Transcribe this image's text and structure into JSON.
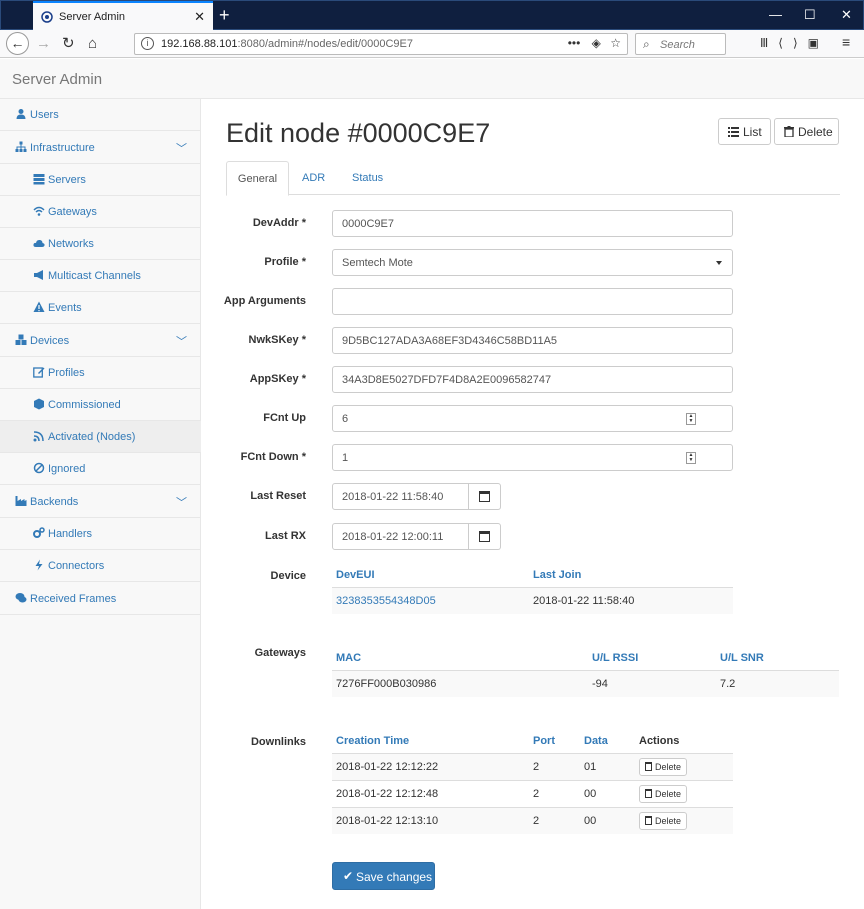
{
  "browser": {
    "tab_title": "Server Admin",
    "url_host": "192.168.88.101",
    "url_rest": ":8080/admin#/nodes/edit/0000C9E7",
    "search_placeholder": "Search",
    "url_actions": "•••"
  },
  "app": {
    "brand": "Server Admin"
  },
  "sidebar": {
    "items": [
      {
        "label": "Users",
        "icon": "user-icon"
      },
      {
        "label": "Infrastructure",
        "icon": "sitemap-icon"
      },
      {
        "label": "Servers",
        "icon": "server-icon"
      },
      {
        "label": "Gateways",
        "icon": "wifi-icon"
      },
      {
        "label": "Networks",
        "icon": "cloud-icon"
      },
      {
        "label": "Multicast Channels",
        "icon": "bullhorn-icon"
      },
      {
        "label": "Events",
        "icon": "warning-icon"
      },
      {
        "label": "Devices",
        "icon": "cubes-icon"
      },
      {
        "label": "Profiles",
        "icon": "edit-icon"
      },
      {
        "label": "Commissioned",
        "icon": "cube-icon"
      },
      {
        "label": "Activated (Nodes)",
        "icon": "rss-icon"
      },
      {
        "label": "Ignored",
        "icon": "ban-icon"
      },
      {
        "label": "Backends",
        "icon": "industry-icon"
      },
      {
        "label": "Handlers",
        "icon": "cogs-icon"
      },
      {
        "label": "Connectors",
        "icon": "bolt-icon"
      },
      {
        "label": "Received Frames",
        "icon": "comments-icon"
      }
    ]
  },
  "page": {
    "title": "Edit node #0000C9E7",
    "list_button": "List",
    "delete_button": "Delete"
  },
  "tabs": [
    "General",
    "ADR",
    "Status"
  ],
  "form": {
    "devaddr_label": "DevAddr *",
    "devaddr_value": "0000C9E7",
    "profile_label": "Profile *",
    "profile_value": "Semtech Mote",
    "app_args_label": "App Arguments",
    "app_args_value": "",
    "nwkskey_label": "NwkSKey *",
    "nwkskey_value": "9D5BC127ADA3A68EF3D4346C58BD11A5",
    "appskey_label": "AppSKey *",
    "appskey_value": "34A3D8E5027DFD7F4D8A2E0096582747",
    "fcntup_label": "FCnt Up",
    "fcntup_value": "6",
    "fcntdown_label": "FCnt Down *",
    "fcntdown_value": "1",
    "lastreset_label": "Last Reset",
    "lastreset_value": "2018-01-22 11:58:40",
    "lastrx_label": "Last RX",
    "lastrx_value": "2018-01-22 12:00:11",
    "device_label": "Device",
    "gateways_label": "Gateways",
    "downlinks_label": "Downlinks"
  },
  "device_table": {
    "headers": [
      "DevEUI",
      "Last Join"
    ],
    "rows": [
      [
        "3238353554348D05",
        "2018-01-22 11:58:40"
      ]
    ]
  },
  "gateways_table": {
    "headers": [
      "MAC",
      "U/L RSSI",
      "U/L SNR"
    ],
    "rows": [
      [
        "7276FF000B030986",
        "-94",
        "7.2"
      ]
    ]
  },
  "downlinks_table": {
    "headers": [
      "Creation Time",
      "Port",
      "Data",
      "Actions"
    ],
    "delete_label": "Delete",
    "rows": [
      [
        "2018-01-22 12:12:22",
        "2",
        "01"
      ],
      [
        "2018-01-22 12:12:48",
        "2",
        "00"
      ],
      [
        "2018-01-22 12:13:10",
        "2",
        "00"
      ]
    ]
  },
  "save_button": "Save changes"
}
